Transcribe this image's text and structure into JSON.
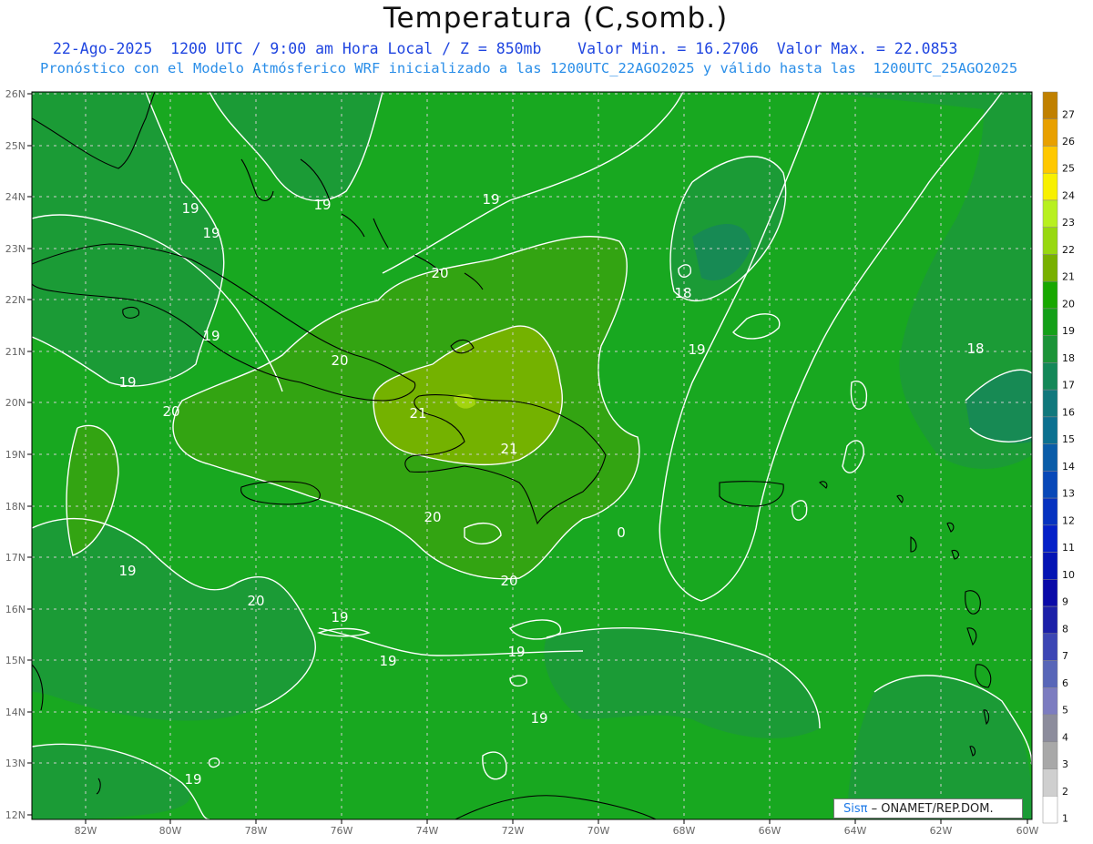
{
  "header": {
    "title": "Temperatura (C,somb.)",
    "line1": "22-Ago-2025  1200 UTC / 9:00 am Hora Local / Z = 850mb    Valor Min. = 16.2706  Valor Max. = 22.0853",
    "line2": "Pronóstico con el Modelo Atmósferico WRF inicializado a las 1200UTC_22AGO2025 y válido hasta las  1200UTC_25AGO2025"
  },
  "axes": {
    "lon_labels": [
      "82W",
      "80W",
      "78W",
      "76W",
      "74W",
      "72W",
      "70W",
      "68W",
      "66W",
      "64W",
      "62W",
      "60W"
    ],
    "lat_labels": [
      "26N",
      "25N",
      "24N",
      "23N",
      "22N",
      "21N",
      "20N",
      "19N",
      "18N",
      "17N",
      "16N",
      "15N",
      "14N",
      "13N",
      "12N"
    ]
  },
  "colorbar": {
    "labels": [
      "27",
      "26",
      "25",
      "24",
      "23",
      "22",
      "21",
      "20",
      "19",
      "18",
      "17",
      "16",
      "15",
      "14",
      "13",
      "12",
      "11",
      "10",
      "9",
      "8",
      "7",
      "6",
      "5",
      "4",
      "3",
      "2",
      "1"
    ],
    "colors": [
      "#c08000",
      "#e8a000",
      "#ffc800",
      "#f8f000",
      "#b8f020",
      "#98d810",
      "#78b000",
      "#18a800",
      "#14a018",
      "#1c9438",
      "#148858",
      "#10787c",
      "#0c7090",
      "#0a5ca8",
      "#0848b8",
      "#0632c0",
      "#0420c8",
      "#0414b4",
      "#0a0aa8",
      "#1c20a8",
      "#3c46b4",
      "#5866b8",
      "#7c7cc0",
      "#8c8c9c",
      "#a8a8a8",
      "#cfcfcf",
      "#ffffff"
    ]
  },
  "contour_labels": [
    "19",
    "19",
    "19",
    "19",
    "19",
    "20",
    "18",
    "20",
    "19",
    "18",
    "19",
    "19",
    "20",
    "21",
    "20",
    "21",
    "20",
    "0",
    "20",
    "19",
    "19",
    "19",
    "19",
    "19",
    "19",
    "19"
  ],
  "credit": {
    "brand": "Sisπ",
    "text": " – ONAMET/REP.DOM."
  },
  "colors": {
    "land_line": "#000000",
    "contour": "#ffffff",
    "grid": "#c8c8c8",
    "bg_green": "#18a818"
  }
}
